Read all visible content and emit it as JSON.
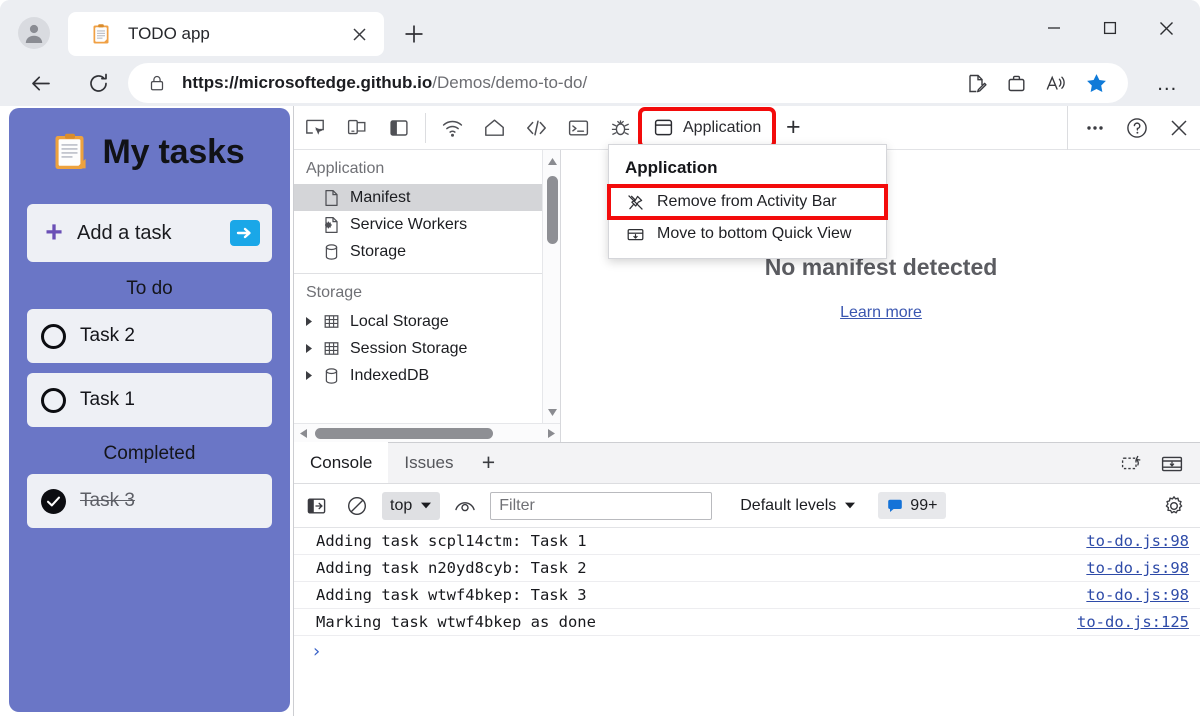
{
  "browser": {
    "tab": {
      "title": "TODO app",
      "favicon": "clipboard-icon",
      "close": "×"
    },
    "new_tab_label": "+",
    "window_controls": {
      "minimize": "—",
      "maximize": "□",
      "close": "✕"
    },
    "address": {
      "scheme_host": "https://microsoftedge.github.io",
      "path": "/Demos/demo-to-do/",
      "lock": "lock-icon"
    },
    "omnibox_actions": [
      "read-aloud-icon",
      "collections-icon",
      "immersive-reader-icon",
      "favorite-icon"
    ],
    "more_menu": "…"
  },
  "todo": {
    "title": "My tasks",
    "add_task": {
      "label": "Add a task",
      "plus": "+",
      "submit": "submit-arrow-icon"
    },
    "sections": [
      {
        "title": "To do",
        "tasks": [
          {
            "label": "Task 2",
            "done": false
          },
          {
            "label": "Task 1",
            "done": false
          }
        ]
      },
      {
        "title": "Completed",
        "tasks": [
          {
            "label": "Task 3",
            "done": true
          }
        ]
      }
    ]
  },
  "devtools": {
    "activity_bar": {
      "left_icons": [
        "inspect-icon",
        "device-emulation-icon",
        "toggle-sidebar-icon"
      ],
      "tool_icons": [
        "network-icon",
        "welcome-home-icon",
        "elements-icon",
        "console-icon",
        "debugger-icon"
      ],
      "active_tab": {
        "label": "Application",
        "icon": "application-icon",
        "highlighted": true
      },
      "add_tab": "+",
      "right_icons": [
        "more-tools-icon",
        "help-icon",
        "close-devtools-icon"
      ]
    },
    "context_menu": {
      "title": "Application",
      "items": [
        {
          "label": "Remove from Activity Bar",
          "icon": "unpin-icon",
          "highlighted": true
        },
        {
          "label": "Move to bottom Quick View",
          "icon": "move-to-quick-view-icon",
          "highlighted": false
        }
      ]
    },
    "application_panel": {
      "groups": [
        {
          "label": "Application",
          "items": [
            {
              "label": "Manifest",
              "icon": "manifest-file-icon",
              "selected": true,
              "twisty": false
            },
            {
              "label": "Service Workers",
              "icon": "service-worker-icon",
              "selected": false,
              "twisty": false
            },
            {
              "label": "Storage",
              "icon": "database-icon",
              "selected": false,
              "twisty": false
            }
          ]
        },
        {
          "label": "Storage",
          "items": [
            {
              "label": "Local Storage",
              "icon": "table-icon",
              "selected": false,
              "twisty": true
            },
            {
              "label": "Session Storage",
              "icon": "table-icon",
              "selected": false,
              "twisty": true
            },
            {
              "label": "IndexedDB",
              "icon": "database-icon",
              "selected": false,
              "twisty": true
            }
          ]
        }
      ],
      "manifest_view": {
        "empty_title": "No manifest detected",
        "learn_more": "Learn more"
      }
    },
    "drawer": {
      "tabs": [
        {
          "label": "Console",
          "active": true
        },
        {
          "label": "Issues",
          "active": false
        }
      ],
      "add_tab": "+",
      "tab_actions": [
        "restore-drawer-icon",
        "dock-drawer-icon"
      ],
      "console_toolbar": {
        "sidebar_toggle": "console-sidebar-icon",
        "clear": "clear-console-icon",
        "context_selector": "top",
        "live_expression": "eye-icon",
        "filter_placeholder": "Filter",
        "levels": "Default levels",
        "issues_badge": "99+",
        "settings": "gear-icon"
      },
      "logs": [
        {
          "message": "Adding task scpl14ctm: Task 1",
          "source": "to-do.js:98"
        },
        {
          "message": "Adding task n20yd8cyb: Task 2",
          "source": "to-do.js:98"
        },
        {
          "message": "Adding task wtwf4bkep: Task 3",
          "source": "to-do.js:98"
        },
        {
          "message": "Marking task wtwf4bkep as done",
          "source": "to-do.js:125"
        }
      ],
      "prompt_symbol": "›"
    }
  },
  "colors": {
    "todo_panel": "#6a76c6",
    "highlight_red": "#f30b0b",
    "favorite_blue": "#0f7ad8",
    "link_blue": "#2e4ba8",
    "submit_cyan": "#1aa7e8"
  }
}
